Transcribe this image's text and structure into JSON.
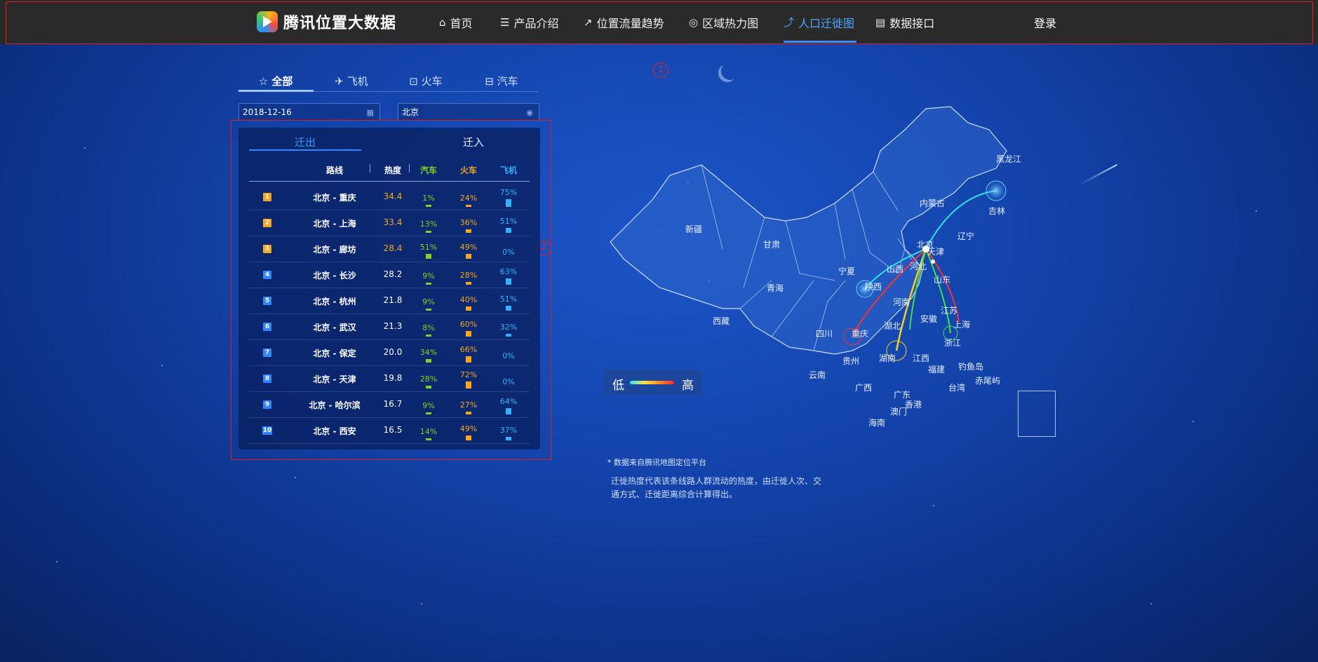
{
  "header": {
    "brand": "腾讯位置大数据",
    "nav": [
      {
        "label": "首页",
        "icon": "home-icon"
      },
      {
        "label": "产品介绍",
        "icon": "list-icon"
      },
      {
        "label": "位置流量趋势",
        "icon": "trend-chart-icon"
      },
      {
        "label": "区域热力图",
        "icon": "heatmap-icon"
      },
      {
        "label": "人口迁徙图",
        "icon": "migration-icon",
        "active": true
      },
      {
        "label": "数据接口",
        "icon": "document-icon"
      }
    ],
    "login": "登录"
  },
  "annotations": [
    "1",
    "2"
  ],
  "transport_tabs": [
    {
      "label": "全部",
      "icon": "star-icon",
      "active": true
    },
    {
      "label": "飞机",
      "icon": "plane-icon"
    },
    {
      "label": "火车",
      "icon": "train-icon"
    },
    {
      "label": "汽车",
      "icon": "car-icon"
    }
  ],
  "filters": {
    "date": "2018-12-16",
    "city": "北京"
  },
  "direction_tabs": [
    {
      "label": "迁出",
      "active": true
    },
    {
      "label": "迁入"
    }
  ],
  "table": {
    "headers": {
      "route": "路线",
      "heat": "热度",
      "car": "汽车",
      "train": "火车",
      "plane": "飞机"
    },
    "rows": [
      {
        "rank": "1",
        "route": "北京 - 重庆",
        "heat": "34.4",
        "car": "1%",
        "train": "24%",
        "plane": "75%"
      },
      {
        "rank": "2",
        "route": "北京 - 上海",
        "heat": "33.4",
        "car": "13%",
        "train": "36%",
        "plane": "51%"
      },
      {
        "rank": "3",
        "route": "北京 - 廊坊",
        "heat": "28.4",
        "car": "51%",
        "train": "49%",
        "plane": "0%"
      },
      {
        "rank": "4",
        "route": "北京 - 长沙",
        "heat": "28.2",
        "car": "9%",
        "train": "28%",
        "plane": "63%"
      },
      {
        "rank": "5",
        "route": "北京 - 杭州",
        "heat": "21.8",
        "car": "9%",
        "train": "40%",
        "plane": "51%"
      },
      {
        "rank": "6",
        "route": "北京 - 武汉",
        "heat": "21.3",
        "car": "8%",
        "train": "60%",
        "plane": "32%"
      },
      {
        "rank": "7",
        "route": "北京 - 保定",
        "heat": "20.0",
        "car": "34%",
        "train": "66%",
        "plane": "0%"
      },
      {
        "rank": "8",
        "route": "北京 - 天津",
        "heat": "19.8",
        "car": "28%",
        "train": "72%",
        "plane": "0%"
      },
      {
        "rank": "9",
        "route": "北京 - 哈尔滨",
        "heat": "16.7",
        "car": "9%",
        "train": "27%",
        "plane": "64%"
      },
      {
        "rank": "10",
        "route": "北京 - 西安",
        "heat": "16.5",
        "car": "14%",
        "train": "49%",
        "plane": "37%"
      }
    ]
  },
  "legend": {
    "low": "低",
    "high": "高"
  },
  "map_labels": [
    "黑龙江",
    "吉林",
    "内蒙古",
    "辽宁",
    "新疆",
    "甘肃",
    "宁夏",
    "北京",
    "天津",
    "山西",
    "河北",
    "陕西",
    "山东",
    "青海",
    "河南",
    "江苏",
    "安徽",
    "上海",
    "西藏",
    "四川",
    "湖北",
    "重庆",
    "浙江",
    "贵州",
    "湖南",
    "江西",
    "福建",
    "钓鱼岛",
    "赤尾屿",
    "台湾",
    "云南",
    "广西",
    "广东",
    "香港",
    "澳门",
    "海南"
  ],
  "notes": {
    "source": "* 数据来自腾讯地图定位平台",
    "description": "迁徙热度代表该条线路人群流动的热度，由迁徙人次、交通方式、迁徙距离综合计算得出。"
  },
  "colors": {
    "car": "#7ed321",
    "train": "#f5a623",
    "plane": "#35b0ff",
    "accent": "#3b8cff",
    "annotation": "#e02020"
  }
}
